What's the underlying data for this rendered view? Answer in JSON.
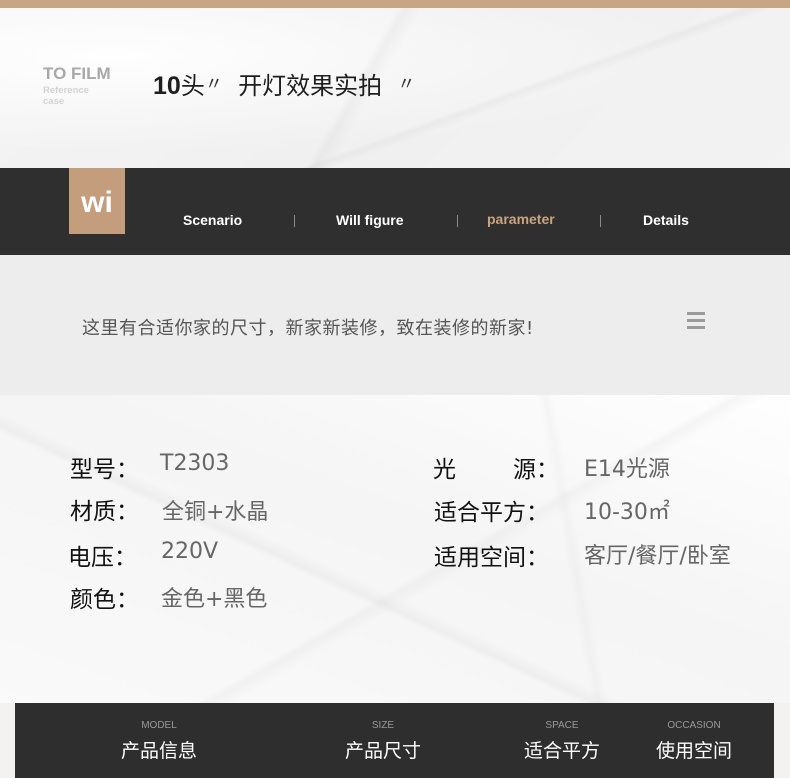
{
  "hero": {
    "brand_title": "TO FILM",
    "brand_sub_1": "Reference",
    "brand_sub_2": "case",
    "headline_num": "10",
    "headline_unit": "头",
    "quote_open": "〃",
    "headline_text": "开灯效果实拍",
    "quote_close": "〃"
  },
  "nav": {
    "logo": "wi",
    "items": [
      {
        "label": "Scenario"
      },
      {
        "label": "Will figure"
      },
      {
        "label": "parameter",
        "active": true
      },
      {
        "label": "Details"
      }
    ]
  },
  "band": {
    "text": "这里有合适你家的尺寸，新家新装修，致在装修的新家!"
  },
  "specs": {
    "model_label": "型号：",
    "model_value": "T2303",
    "material_label": "材质：",
    "material_value": "全铜+水晶",
    "voltage_label": "电压：",
    "voltage_value": "220V",
    "color_label": "颜色：",
    "color_value": "金色+黑色",
    "light_label_a": "光",
    "light_label_b": "源：",
    "light_value": "E14光源",
    "area_label": "适合平方：",
    "area_value": "10-30㎡",
    "space_label": "适用空间：",
    "space_value": "客厅/餐厅/卧室"
  },
  "footer": {
    "tabs": [
      {
        "en": "MODEL",
        "cn": "产品信息"
      },
      {
        "en": "SIZE",
        "cn": "产品尺寸"
      },
      {
        "en": "SPACE",
        "cn": "适合平方"
      },
      {
        "en": "OCCASION",
        "cn": "使用空间"
      }
    ]
  },
  "colors": {
    "accent": "#c39d7c",
    "nav_bg": "#2f2f2f",
    "active_nav": "#c9a47f"
  },
  "icons": {
    "menu": "hamburger-menu-icon"
  }
}
